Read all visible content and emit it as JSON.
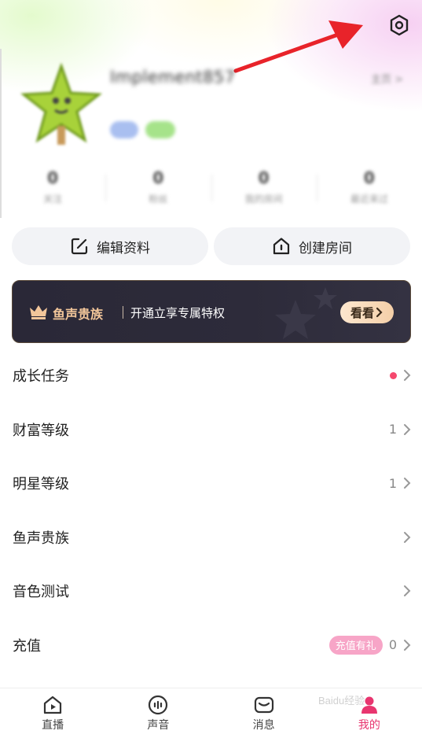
{
  "header": {
    "username": "Implement857",
    "profile_link": "主页 >",
    "stats": [
      {
        "value": "0",
        "label": "关注"
      },
      {
        "value": "0",
        "label": "粉丝"
      },
      {
        "value": "0",
        "label": "我的房间"
      },
      {
        "value": "0",
        "label": "最近来过"
      }
    ]
  },
  "actions": {
    "edit_label": "编辑资料",
    "create_label": "创建房间"
  },
  "banner": {
    "title": "鱼声贵族",
    "description": "开通立享专属特权",
    "button_label": "看看",
    "colors": {
      "title": "#f2c69a",
      "background": "#2a2837"
    }
  },
  "menu": [
    {
      "label": "成长任务",
      "value": "",
      "dot": true,
      "tag": ""
    },
    {
      "label": "财富等级",
      "value": "1",
      "dot": false,
      "tag": ""
    },
    {
      "label": "明星等级",
      "value": "1",
      "dot": false,
      "tag": ""
    },
    {
      "label": "鱼声贵族",
      "value": "",
      "dot": false,
      "tag": ""
    },
    {
      "label": "音色测试",
      "value": "",
      "dot": false,
      "tag": ""
    },
    {
      "label": "充值",
      "value": "0",
      "dot": false,
      "tag": "充值有礼"
    }
  ],
  "nav": {
    "items": [
      {
        "label": "直播",
        "icon": "home-icon"
      },
      {
        "label": "声音",
        "icon": "voice-icon"
      },
      {
        "label": "消息",
        "icon": "message-icon"
      },
      {
        "label": "我的",
        "icon": "profile-icon"
      }
    ],
    "active_index": 3,
    "accent": "#e8356f"
  },
  "watermark": "Baidu经验"
}
